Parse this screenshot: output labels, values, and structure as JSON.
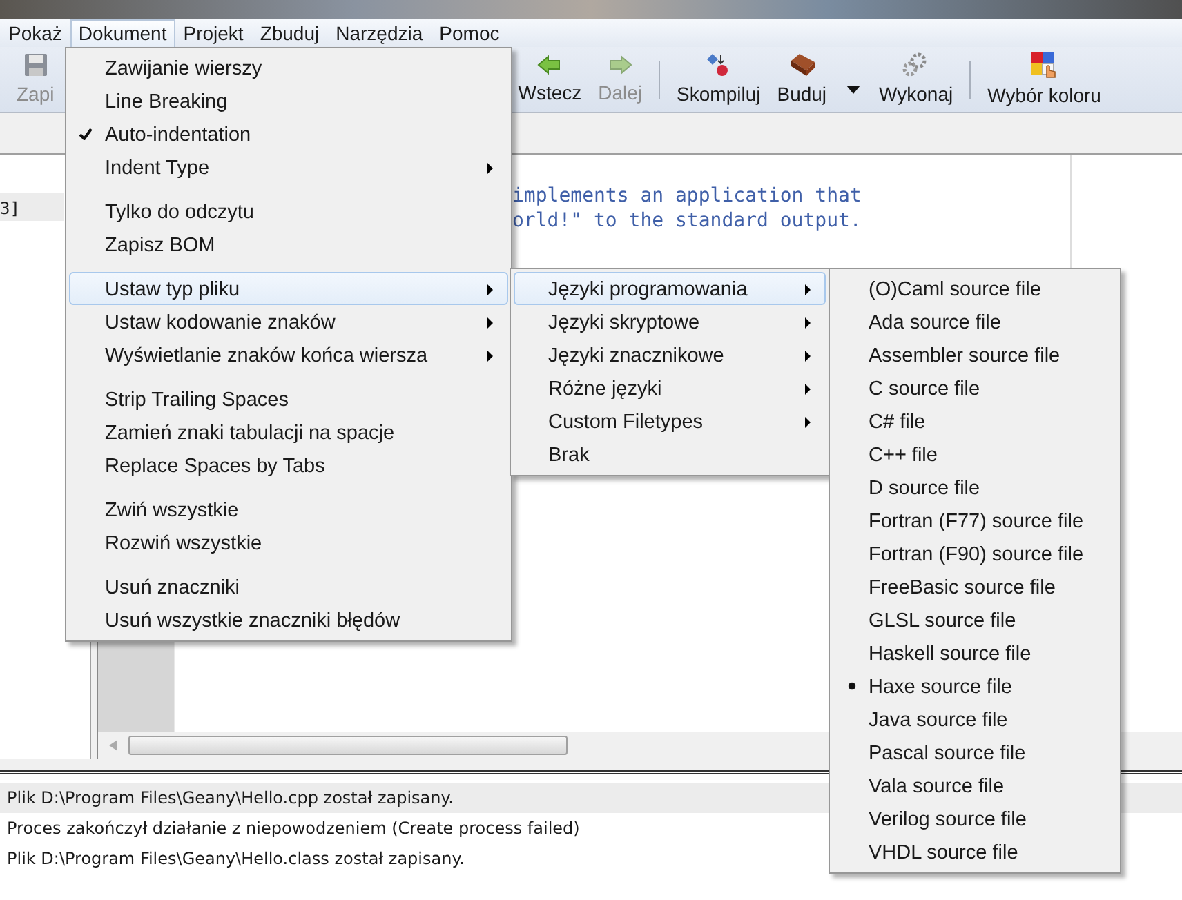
{
  "menubar": [
    {
      "label": "Pokaż",
      "selected": false
    },
    {
      "label": "Dokument",
      "selected": true
    },
    {
      "label": "Projekt",
      "selected": false
    },
    {
      "label": "Zbuduj",
      "selected": false
    },
    {
      "label": "Narzędzia",
      "selected": false
    },
    {
      "label": "Pomoc",
      "selected": false
    }
  ],
  "toolbar": [
    {
      "kind": "button",
      "label": "Zapi",
      "disabled": true
    },
    {
      "kind": "button",
      "label": "Wstecz",
      "disabled": false
    },
    {
      "kind": "button",
      "label": "Dalej",
      "disabled": true
    },
    {
      "kind": "separator"
    },
    {
      "kind": "button",
      "label": "Skompiluj",
      "disabled": false
    },
    {
      "kind": "button",
      "label": "Buduj",
      "disabled": false
    },
    {
      "kind": "dropdown"
    },
    {
      "kind": "button",
      "label": "Wykonaj",
      "disabled": false
    },
    {
      "kind": "separator"
    },
    {
      "kind": "button",
      "label": "Wybór koloru",
      "disabled": false
    }
  ],
  "sidebar": {
    "items": [
      {
        "label": "3]",
        "selected": true
      }
    ]
  },
  "editor": {
    "lines": [
      "implements an application that",
      "orld!\" to the standard output."
    ]
  },
  "messages": [
    {
      "text": "Plik D:\\Program Files\\Geany\\Hello.cpp został zapisany.",
      "selected": true
    },
    {
      "text": "Proces zakończył działanie z niepowodzeniem (Create process failed)",
      "selected": false
    },
    {
      "text": "Plik D:\\Program Files\\Geany\\Hello.class został zapisany.",
      "selected": false
    }
  ],
  "document_menu": [
    {
      "kind": "item",
      "label": "Zawijanie wierszy",
      "checked": false,
      "submenu": false,
      "selected": false
    },
    {
      "kind": "item",
      "label": "Line Breaking",
      "checked": false,
      "submenu": false,
      "selected": false
    },
    {
      "kind": "item",
      "label": "Auto-indentation",
      "checked": true,
      "submenu": false,
      "selected": false
    },
    {
      "kind": "item",
      "label": "Indent Type",
      "checked": false,
      "submenu": true,
      "selected": false
    },
    {
      "kind": "separator"
    },
    {
      "kind": "item",
      "label": "Tylko do odczytu",
      "checked": false,
      "submenu": false,
      "selected": false
    },
    {
      "kind": "item",
      "label": "Zapisz BOM",
      "checked": false,
      "submenu": false,
      "selected": false
    },
    {
      "kind": "separator"
    },
    {
      "kind": "item",
      "label": "Ustaw typ pliku",
      "checked": false,
      "submenu": true,
      "selected": true
    },
    {
      "kind": "item",
      "label": "Ustaw kodowanie znaków",
      "checked": false,
      "submenu": true,
      "selected": false
    },
    {
      "kind": "item",
      "label": "Wyświetlanie znaków końca wiersza",
      "checked": false,
      "submenu": true,
      "selected": false
    },
    {
      "kind": "separator"
    },
    {
      "kind": "item",
      "label": "Strip Trailing Spaces",
      "checked": false,
      "submenu": false,
      "selected": false
    },
    {
      "kind": "item",
      "label": "Zamień znaki tabulacji na spacje",
      "checked": false,
      "submenu": false,
      "selected": false
    },
    {
      "kind": "item",
      "label": "Replace Spaces by Tabs",
      "checked": false,
      "submenu": false,
      "selected": false
    },
    {
      "kind": "separator"
    },
    {
      "kind": "item",
      "label": "Zwiń wszystkie",
      "checked": false,
      "submenu": false,
      "selected": false
    },
    {
      "kind": "item",
      "label": "Rozwiń wszystkie",
      "checked": false,
      "submenu": false,
      "selected": false
    },
    {
      "kind": "separator"
    },
    {
      "kind": "item",
      "label": "Usuń znaczniki",
      "checked": false,
      "submenu": false,
      "selected": false
    },
    {
      "kind": "item",
      "label": "Usuń wszystkie znaczniki błędów",
      "checked": false,
      "submenu": false,
      "selected": false
    }
  ],
  "filetype_menu": [
    {
      "label": "Języki programowania",
      "submenu": true,
      "selected": true
    },
    {
      "label": "Języki skryptowe",
      "submenu": true,
      "selected": false
    },
    {
      "label": "Języki znacznikowe",
      "submenu": true,
      "selected": false
    },
    {
      "label": "Różne języki",
      "submenu": true,
      "selected": false
    },
    {
      "label": "Custom Filetypes",
      "submenu": true,
      "selected": false
    },
    {
      "label": "Brak",
      "submenu": false,
      "selected": false
    }
  ],
  "programming_menu": [
    {
      "label": "(O)Caml source file",
      "checked": false
    },
    {
      "label": "Ada source file",
      "checked": false
    },
    {
      "label": "Assembler source file",
      "checked": false
    },
    {
      "label": "C source file",
      "checked": false
    },
    {
      "label": "C# file",
      "checked": false
    },
    {
      "label": "C++ file",
      "checked": false
    },
    {
      "label": "D source file",
      "checked": false
    },
    {
      "label": "Fortran (F77) source file",
      "checked": false
    },
    {
      "label": "Fortran (F90) source file",
      "checked": false
    },
    {
      "label": "FreeBasic source file",
      "checked": false
    },
    {
      "label": "GLSL source file",
      "checked": false
    },
    {
      "label": "Haskell source file",
      "checked": false
    },
    {
      "label": "Haxe source file",
      "checked": true
    },
    {
      "label": "Java source file",
      "checked": false
    },
    {
      "label": "Pascal source file",
      "checked": false
    },
    {
      "label": "Vala source file",
      "checked": false
    },
    {
      "label": "Verilog source file",
      "checked": false
    },
    {
      "label": "VHDL source file",
      "checked": false
    }
  ]
}
